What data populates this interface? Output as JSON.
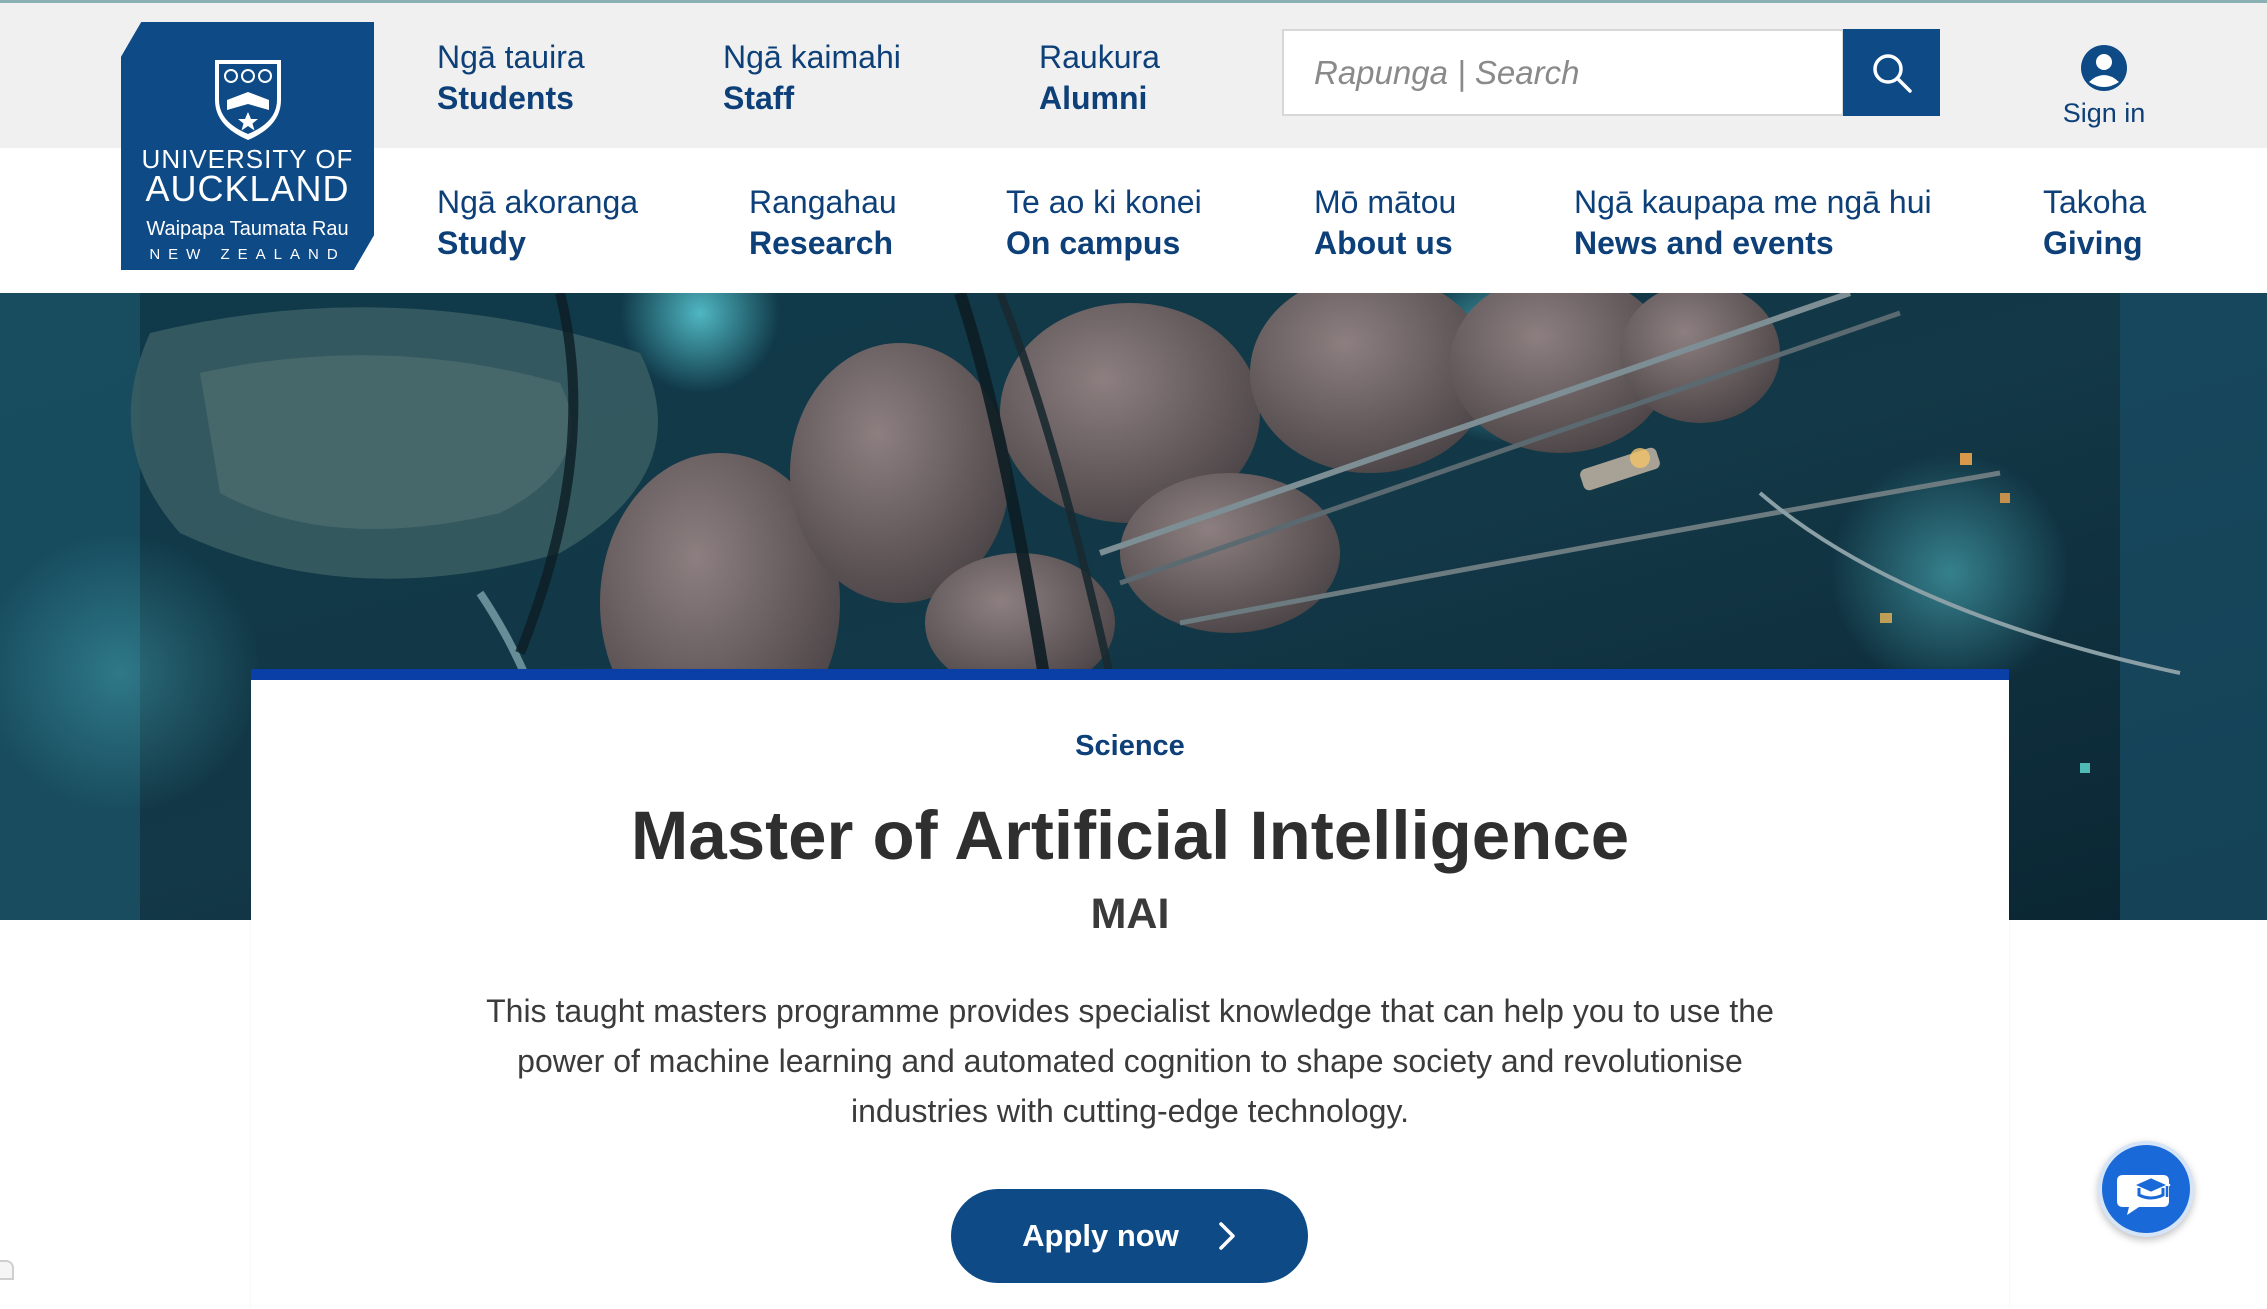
{
  "brand": {
    "line1": "UNIVERSITY OF",
    "line2": "AUCKLAND",
    "line3": "Waipapa Taumata Rau",
    "line4": "NEW ZEALAND",
    "color": "#0d4a86"
  },
  "utility_nav": [
    {
      "maori": "Ngā tauira",
      "english": "Students"
    },
    {
      "maori": "Ngā kaimahi",
      "english": "Staff"
    },
    {
      "maori": "Raukura",
      "english": "Alumni"
    }
  ],
  "search": {
    "placeholder": "Rapunga | Search",
    "value": "",
    "icon": "search-icon"
  },
  "account": {
    "label": "Sign in",
    "icon": "user-icon"
  },
  "main_nav": [
    {
      "maori": "Ngā akoranga",
      "english": "Study"
    },
    {
      "maori": "Rangahau",
      "english": "Research"
    },
    {
      "maori": "Te ao ki konei",
      "english": "On campus"
    },
    {
      "maori": "Mō mātou",
      "english": "About us"
    },
    {
      "maori": "Ngā kaupapa me ngā hui",
      "english": "News and events"
    },
    {
      "maori": "Takoha",
      "english": "Giving"
    }
  ],
  "programme": {
    "faculty": "Science",
    "title": "Master of Artificial Intelligence",
    "abbreviation": "MAI",
    "description": "This taught masters programme provides specialist knowledge that can help you to use the power of machine learning and automated cognition to shape society and revolutionise industries with cutting-edge technology.",
    "cta_label": "Apply now",
    "cta_icon": "chevron-right-icon"
  },
  "chat": {
    "icon": "chat-graduation-icon"
  },
  "colors": {
    "primary": "#0d4a86",
    "card_accent": "#0b3fa8",
    "chat_button": "#1a69d8",
    "utility_bar": "#f0f0f0"
  }
}
